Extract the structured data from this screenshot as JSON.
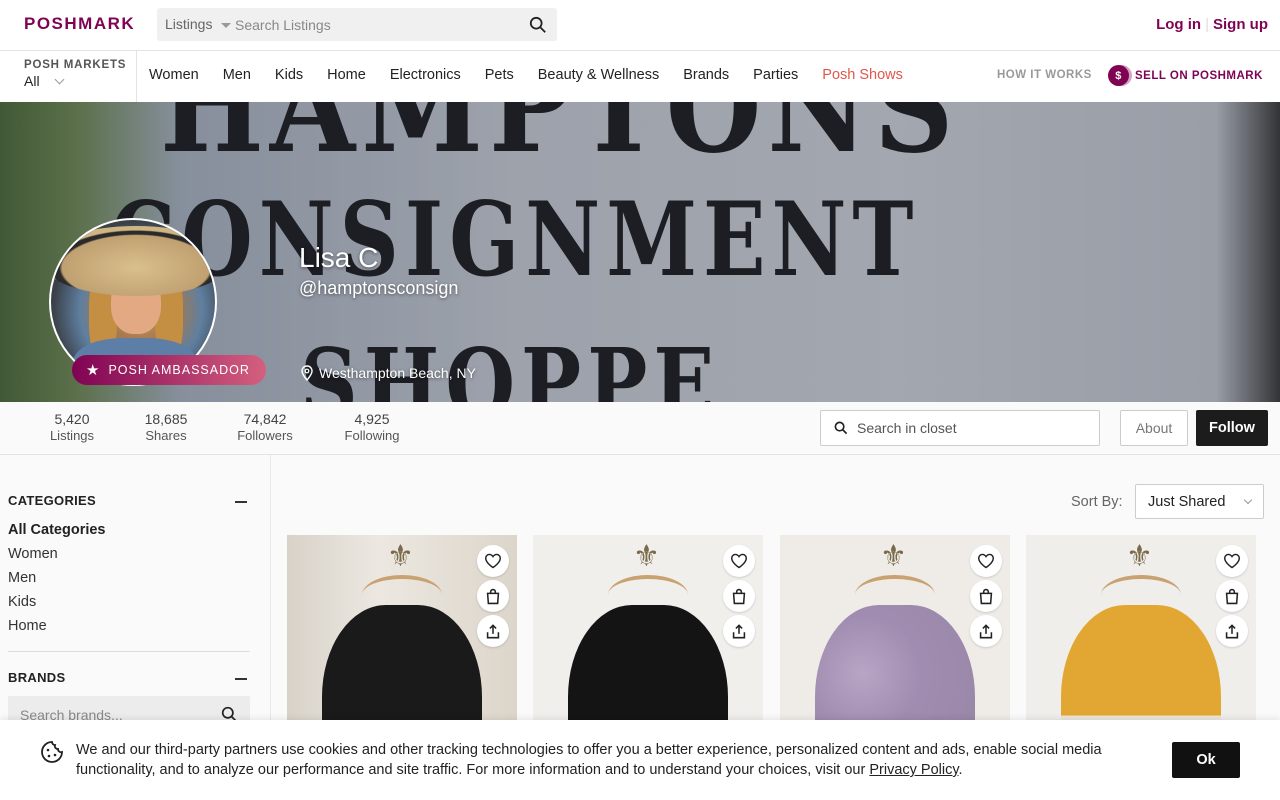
{
  "header": {
    "logo": "POSHMARK",
    "search": {
      "type_label": "Listings",
      "placeholder": "Search Listings"
    },
    "login": "Log in",
    "separator": "|",
    "signup": "Sign up"
  },
  "nav": {
    "markets_label": "POSH MARKETS",
    "markets_value": "All",
    "links": [
      "Women",
      "Men",
      "Kids",
      "Home",
      "Electronics",
      "Pets",
      "Beauty & Wellness",
      "Brands",
      "Parties",
      "Posh Shows"
    ],
    "how_it_works": "HOW IT WORKS",
    "sell_coin": "$",
    "sell_label": "SELL ON POSHMARK"
  },
  "profile": {
    "banner_text": [
      "HAMPTONS",
      "CONSIGNMENT",
      "SHOPPE"
    ],
    "badge": "POSH AMBASSADOR",
    "name": "Lisa C",
    "handle": "@hamptonsconsign",
    "location": "Westhampton Beach, NY"
  },
  "stats": [
    {
      "value": "5,420",
      "label": "Listings"
    },
    {
      "value": "18,685",
      "label": "Shares"
    },
    {
      "value": "74,842",
      "label": "Followers"
    },
    {
      "value": "4,925",
      "label": "Following"
    }
  ],
  "closet_search": {
    "placeholder": "Search in closet"
  },
  "actions": {
    "about": "About",
    "follow": "Follow"
  },
  "sidebar": {
    "categories_title": "CATEGORIES",
    "categories": [
      "All Categories",
      "Women",
      "Men",
      "Kids",
      "Home"
    ],
    "brands_title": "BRANDS",
    "brand_search_placeholder": "Search brands..."
  },
  "listing": {
    "sort_label": "Sort By:",
    "sort_value": "Just Shared"
  },
  "cookie": {
    "message": "We and our third-party partners use cookies and other tracking technologies to offer you a better experience, personalized content and ads, enable social media functionality, and to analyze our performance and site traffic. For more information and to understand your choices, visit our",
    "link": "Privacy Policy",
    "period": ".",
    "ok": "Ok"
  },
  "colors": {
    "brand": "#7f0353",
    "posh_shows": "#e0574b",
    "follow_bg": "#1c1c1c"
  }
}
